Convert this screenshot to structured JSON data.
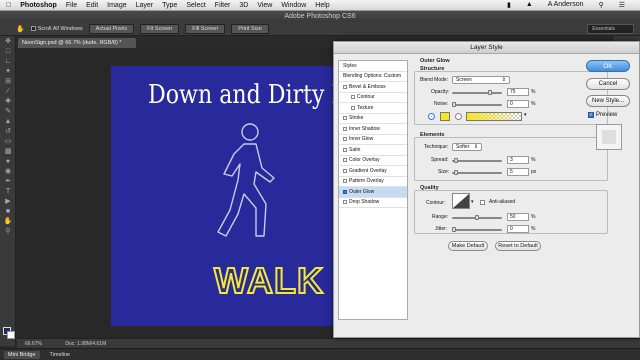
{
  "menubar": {
    "apple": "",
    "app": "Photoshop",
    "items": [
      "File",
      "Edit",
      "Image",
      "Layer",
      "Type",
      "Select",
      "Filter",
      "3D",
      "View",
      "Window",
      "Help"
    ],
    "user": "A Anderson"
  },
  "window": {
    "title": "Adobe Photoshop CS6"
  },
  "options": {
    "scroll_all": "Scroll All Windows",
    "actual_pixels": "Actual Pixels",
    "fit_screen": "Fit Screen",
    "fill_screen": "Fill Screen",
    "print_size": "Print Size",
    "workspace": "Essentials"
  },
  "document": {
    "tab": "NeonSign.psd @ 66.7% (dude, RGB/8) *",
    "sign_title": "Down and Dirty N",
    "walk_text": "WALK"
  },
  "status": {
    "zoom": "66.67%",
    "doc": "Doc: 1.98M/4.61M"
  },
  "bottom_tabs": [
    "Mini Bridge",
    "Timeline"
  ],
  "dialog": {
    "title": "Layer Style",
    "styles": [
      {
        "label": "Styles",
        "type": "head"
      },
      {
        "label": "Blending Options: Custom",
        "type": "head"
      },
      {
        "label": "Bevel & Emboss",
        "type": "item"
      },
      {
        "label": "Contour",
        "type": "indent"
      },
      {
        "label": "Texture",
        "type": "indent"
      },
      {
        "label": "Stroke",
        "type": "item"
      },
      {
        "label": "Inner Shadow",
        "type": "item"
      },
      {
        "label": "Inner Glow",
        "type": "item"
      },
      {
        "label": "Satin",
        "type": "item"
      },
      {
        "label": "Color Overlay",
        "type": "item"
      },
      {
        "label": "Gradient Overlay",
        "type": "item"
      },
      {
        "label": "Pattern Overlay",
        "type": "item"
      },
      {
        "label": "Outer Glow",
        "type": "item",
        "checked": true,
        "selected": true
      },
      {
        "label": "Drop Shadow",
        "type": "item"
      }
    ],
    "outer_glow": {
      "heading": "Outer Glow",
      "structure": "Structure",
      "blend_mode_label": "Blend Mode:",
      "blend_mode": "Screen",
      "opacity_label": "Opacity:",
      "opacity": "75",
      "noise_label": "Noise:",
      "noise": "0",
      "pct": "%",
      "glow_color": "#f6e622"
    },
    "elements": {
      "heading": "Elements",
      "technique_label": "Technique:",
      "technique": "Softer",
      "spread_label": "Spread:",
      "spread": "3",
      "size_label": "Size:",
      "size": "5",
      "px": "px"
    },
    "quality": {
      "heading": "Quality",
      "contour_label": "Contour:",
      "anti_aliased": "Anti-aliased",
      "range_label": "Range:",
      "range": "50",
      "jitter_label": "Jitter:",
      "jitter": "0"
    },
    "make_default": "Make Default",
    "reset_default": "Reset to Default",
    "ok": "OK",
    "cancel": "Cancel",
    "new_style": "New Style...",
    "preview": "Preview"
  }
}
